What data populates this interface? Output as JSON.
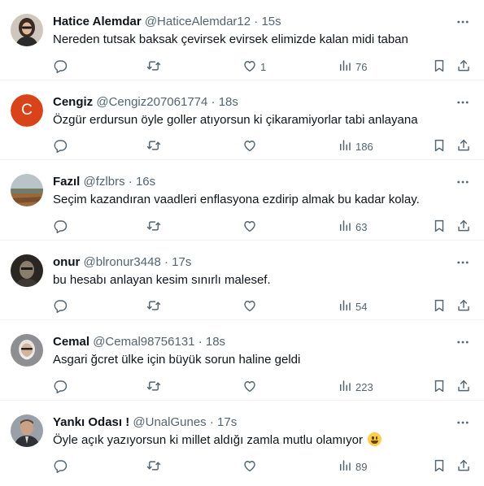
{
  "tweets": [
    {
      "name": "Hatice Alemdar",
      "handle": "@HaticeAlemdar12",
      "time": "15s",
      "text": "Nereden tutsak baksak çevirsek evirsek elimizde kalan midi taban",
      "replies": "",
      "retweets": "",
      "likes": "1",
      "views": "76",
      "avatar": "photo-woman"
    },
    {
      "name": "Cengiz",
      "handle": "@Cengiz207061774",
      "time": "18s",
      "text": "Özgür erdursun öyle goller atıyorsun ki çikaramiyorlar tabi anlayana",
      "replies": "",
      "retweets": "",
      "likes": "",
      "views": "186",
      "avatar": "letter",
      "avatar_letter": "C",
      "avatar_color": "#d9431a"
    },
    {
      "name": "Fazıl",
      "handle": "@fzlbrs",
      "time": "16s",
      "text": "Seçim kazandıran vaadleri enflasyona ezdirip almak bu kadar kolay.",
      "replies": "",
      "retweets": "",
      "likes": "",
      "views": "63",
      "avatar": "photo-landscape"
    },
    {
      "name": "onur",
      "handle": "@blronur3448",
      "time": "17s",
      "text": "bu hesabı anlayan kesim sınırlı malesef.",
      "replies": "",
      "retweets": "",
      "likes": "",
      "views": "54",
      "avatar": "photo-dark"
    },
    {
      "name": "Cemal",
      "handle": "@Cemal98756131",
      "time": "18s",
      "text": "Asgari ğcret ülke için büyük sorun haline geldi",
      "replies": "",
      "retweets": "",
      "likes": "",
      "views": "223",
      "avatar": "photo-man-grey"
    },
    {
      "name": "Yankı Odası !",
      "handle": "@UnalGunes",
      "time": "17s",
      "text": "Öyle açık yazıyorsun ki millet aldığı zamla mutlu olamıyor",
      "text_emoji": "grinning-face-emoji",
      "replies": "",
      "retweets": "",
      "likes": "",
      "views": "89",
      "avatar": "photo-man-suit"
    }
  ],
  "colors": {
    "text": "#0f1419",
    "muted": "#536471",
    "divider": "#eff3f4"
  }
}
